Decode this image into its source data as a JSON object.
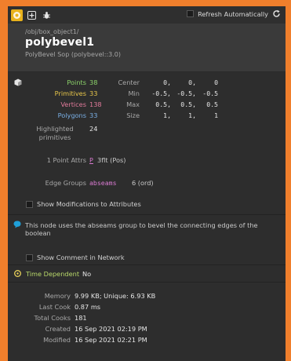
{
  "toolbar": {
    "refresh_label": "Refresh Automatically"
  },
  "node": {
    "path": "/obj/box_object1/",
    "name": "polybevel1",
    "type": "PolyBevel Sop (polybevel::3.0)"
  },
  "geometry": {
    "points_label": "Points",
    "points": "38",
    "primitives_label": "Primitives",
    "primitives": "33",
    "vertices_label": "Vertices",
    "vertices": "138",
    "polygons_label": "Polygons",
    "polygons": "33",
    "highlighted_label": "Highlighted primitives",
    "highlighted": "24",
    "bbox": {
      "center_label": "Center",
      "center": [
        "0,",
        "0,",
        "0"
      ],
      "min_label": "Min",
      "min": [
        "-0.5,",
        "-0.5,",
        "-0.5"
      ],
      "max_label": "Max",
      "max": [
        "0.5,",
        "0.5,",
        "0.5"
      ],
      "size_label": "Size",
      "size": [
        "1,",
        "1,",
        "1"
      ]
    },
    "point_attrs_label": "1 Point Attrs",
    "point_attr_name": "P",
    "point_attr_type": "3flt (Pos)",
    "edge_groups_label": "Edge Groups",
    "edge_group_name": "abseams",
    "edge_group_info": "6 (ord)",
    "show_modifications_label": "Show Modifications to Attributes"
  },
  "comment": {
    "text": "This node uses the abseams group to bevel the connecting edges of the boolean",
    "show_in_network_label": "Show Comment in Network"
  },
  "time": {
    "label": "Time Dependent",
    "value": "No"
  },
  "meta": {
    "memory_label": "Memory",
    "memory": "9.99 KB; Unique: 6.93 KB",
    "last_cook_label": "Last Cook",
    "last_cook": "0.87 ms",
    "total_cooks_label": "Total Cooks",
    "total_cooks": "181",
    "created_label": "Created",
    "created": "16 Sep 2021 02:19 PM",
    "modified_label": "Modified",
    "modified": "16 Sep 2021 02:21 PM"
  },
  "colors": {
    "points": "#8cd36a",
    "primitives": "#e8c64a",
    "vertices": "#e07a9a",
    "polygons": "#7ab0e6",
    "group": "#d87ad0",
    "comment_icon": "#1f9fd8",
    "time_label": "#b8d86a",
    "accent": "#f07f2c"
  }
}
